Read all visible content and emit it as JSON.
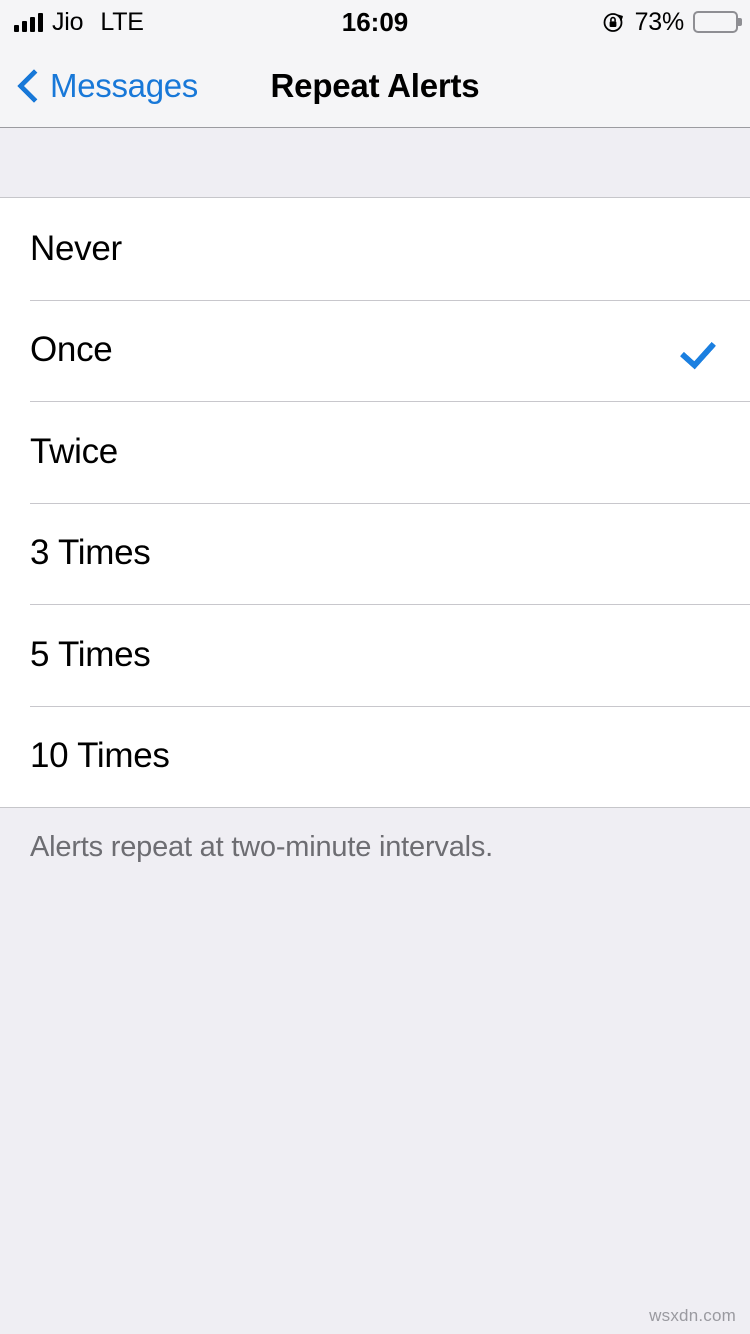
{
  "status_bar": {
    "carrier": "Jio",
    "network": "LTE",
    "signal_bars": 4,
    "time": "16:09",
    "battery_percent_label": "73%",
    "battery_level": 73,
    "rotation_lock_icon": "rotation-lock-icon",
    "signal_icon": "signal-bars-icon",
    "battery_icon": "battery-icon"
  },
  "nav_bar": {
    "back_label": "Messages",
    "back_icon": "chevron-left-icon",
    "title": "Repeat Alerts"
  },
  "options": [
    {
      "label": "Never",
      "selected": false
    },
    {
      "label": "Once",
      "selected": true
    },
    {
      "label": "Twice",
      "selected": false
    },
    {
      "label": "3 Times",
      "selected": false
    },
    {
      "label": "5 Times",
      "selected": false
    },
    {
      "label": "10 Times",
      "selected": false
    }
  ],
  "footer": {
    "text": "Alerts repeat at two-minute intervals."
  },
  "watermark": {
    "text": "wsxdn.com"
  },
  "colors": {
    "accent_blue": "#1878D8",
    "checkmark_blue": "#1B7FE0",
    "group_background": "#EFEEF3",
    "row_background": "#FFFFFF",
    "separator": "#C8C7CC",
    "bar_background": "#F5F5F7",
    "footer_text": "#6D6D72"
  }
}
